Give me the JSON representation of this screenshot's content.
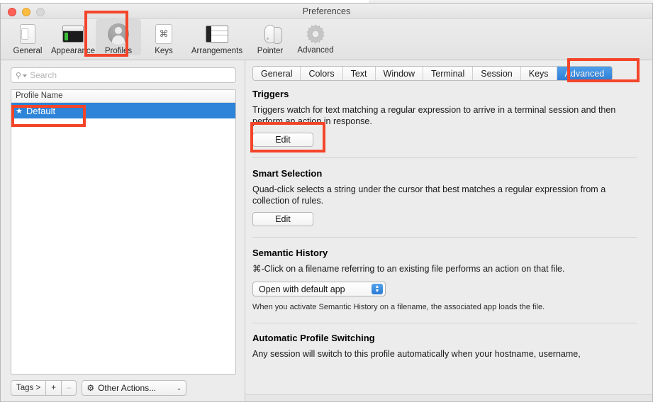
{
  "background_window": {
    "ghost_text": ""
  },
  "window": {
    "title": "Preferences",
    "traffic_lights": {
      "close": "close",
      "minimize": "minimize",
      "zoom": "zoom"
    }
  },
  "toolbar": {
    "items": [
      {
        "label": "General",
        "icon": "note-page-icon",
        "selected": false
      },
      {
        "label": "Appearance",
        "icon": "window-appearance-icon",
        "selected": false
      },
      {
        "label": "Profiles",
        "icon": "person-circle-icon",
        "selected": true
      },
      {
        "label": "Keys",
        "icon": "command-key-icon",
        "selected": false
      },
      {
        "label": "Arrangements",
        "icon": "window-arrangement-icon",
        "selected": false
      },
      {
        "label": "Pointer",
        "icon": "mouse-icon",
        "selected": false
      },
      {
        "label": "Advanced",
        "icon": "gear-icon",
        "selected": false
      }
    ]
  },
  "sidebar": {
    "search": {
      "placeholder": "Search",
      "value": "",
      "icon": "search-icon"
    },
    "list": {
      "column_header": "Profile Name",
      "rows": [
        {
          "label": "Default",
          "starred": true,
          "star_glyph": "★",
          "selected": true
        }
      ]
    },
    "footer": {
      "tags_label": "Tags >",
      "add_label": "+",
      "remove_label": "–",
      "other_actions_label": "Other Actions...",
      "other_actions_icon": "gear-icon",
      "other_actions_caret": "⌄"
    }
  },
  "tabs": [
    {
      "label": "General",
      "active": false
    },
    {
      "label": "Colors",
      "active": false
    },
    {
      "label": "Text",
      "active": false
    },
    {
      "label": "Window",
      "active": false
    },
    {
      "label": "Terminal",
      "active": false
    },
    {
      "label": "Session",
      "active": false
    },
    {
      "label": "Keys",
      "active": false
    },
    {
      "label": "Advanced",
      "active": true
    }
  ],
  "sections": {
    "triggers": {
      "title": "Triggers",
      "description": "Triggers watch for text matching a regular expression to arrive in a terminal session and then perform an action in response.",
      "edit_label": "Edit"
    },
    "smart_selection": {
      "title": "Smart Selection",
      "description": "Quad-click selects a string under the cursor that best matches a regular expression from a collection of rules.",
      "edit_label": "Edit"
    },
    "semantic_history": {
      "title": "Semantic History",
      "description": "⌘-Click on a filename referring to an existing file performs an action on that file.",
      "popup_value": "Open with default app",
      "note": "When you activate Semantic History on a filename, the associated app loads the file."
    },
    "automatic_profile_switching": {
      "title": "Automatic Profile Switching",
      "description": "Any session will switch to this profile automatically when your hostname, username,"
    }
  },
  "watermark": {
    "text": ""
  },
  "colors": {
    "highlight_red": "#f4452a",
    "selection_blue": "#2d84d8",
    "tab_active_blue": "#2f7fd8",
    "window_bg": "#ececec"
  }
}
